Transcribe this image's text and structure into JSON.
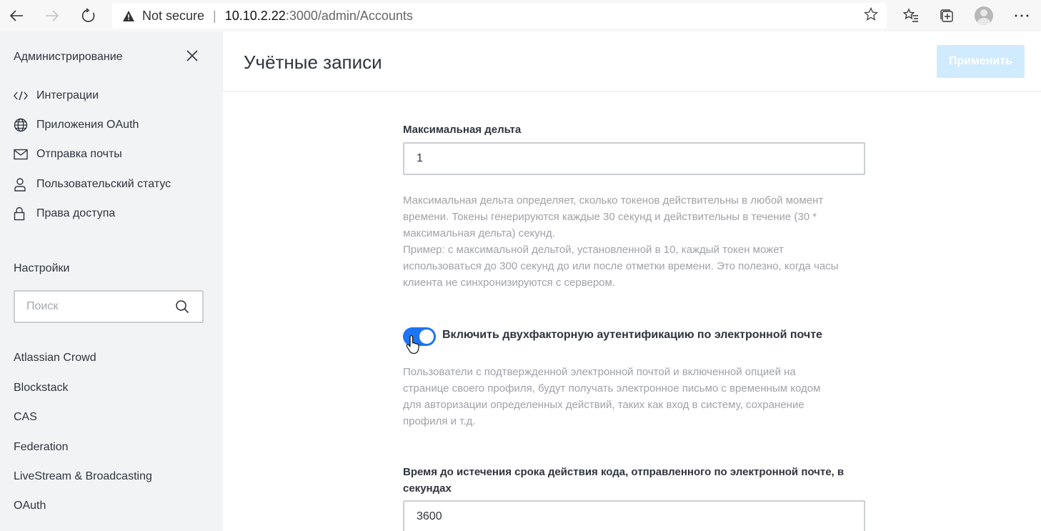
{
  "browser": {
    "not_secure_label": "Not secure",
    "url_host": "10.10.2.22",
    "url_path": ":3000/admin/Accounts",
    "icons": [
      "back-icon",
      "forward-icon",
      "refresh-icon",
      "warning-icon",
      "star-icon",
      "favorites-icon",
      "collections-icon",
      "profile-icon",
      "more-icon"
    ]
  },
  "sidebar": {
    "title": "Администрирование",
    "items": [
      {
        "label": "Интеграции",
        "icon": "code-icon"
      },
      {
        "label": "Приложения OAuth",
        "icon": "globe-icon"
      },
      {
        "label": "Отправка почты",
        "icon": "mail-icon"
      },
      {
        "label": "Пользовательский статус",
        "icon": "user-icon"
      },
      {
        "label": "Права доступа",
        "icon": "lock-icon"
      }
    ],
    "settings_title": "Настройки",
    "search_placeholder": "Поиск",
    "settings_links": [
      "Atlassian Crowd",
      "Blockstack",
      "CAS",
      "Federation",
      "LiveStream & Broadcasting",
      "OAuth"
    ]
  },
  "main": {
    "title": "Учётные записи",
    "apply_label": "Применить",
    "apply_color": "#d1ebfe",
    "max_delta": {
      "label": "Максимальная дельта",
      "value": "1",
      "hint_lines": [
        "Максимальная дельта определяет, сколько токенов действительны в любой момент",
        "времени. Токены генерируются каждые 30 секунд и действительны в течение (30 *",
        "максимальная дельта) секунд.",
        "Пример: с максимальной дельтой, установленной в 10, каждый токен может",
        "использоваться до 300 секунд до или после отметки времени. Это полезно, когда часы",
        "клиента не синхронизируются с сервером."
      ]
    },
    "email_2fa": {
      "label": "Включить двухфакторную аутентификацию по электронной почте",
      "enabled": true,
      "toggle_color": "#1d74f5",
      "hint_lines": [
        "Пользователи с подтвержденной электронной почтой и включенной опцией на",
        "странице своего профиля, будут получать электронное письмо с временным кодом",
        "для авторизации определенных действий, таких как вход в систему, сохранение",
        "профиля и т.д."
      ]
    },
    "code_expiry": {
      "label_lines": [
        "Время до истечения срока действия кода, отправленного по электронной почте, в",
        "секундах"
      ],
      "value": "3600"
    }
  }
}
